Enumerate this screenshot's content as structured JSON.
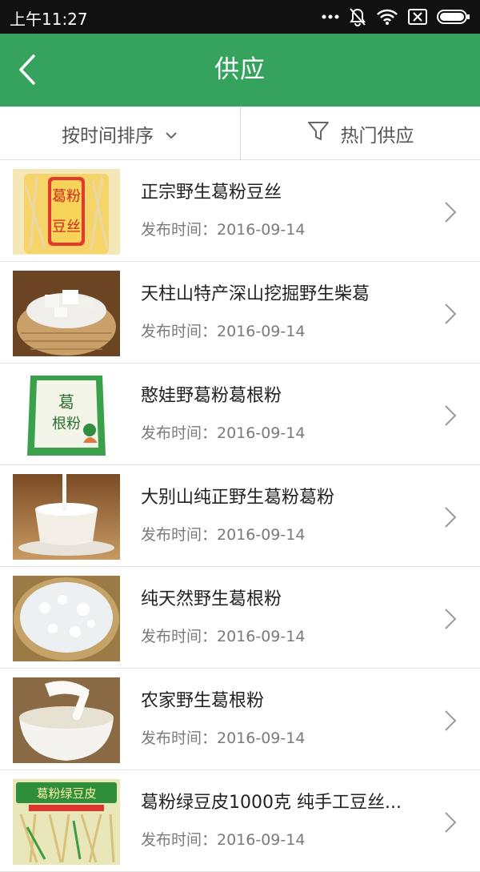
{
  "status_bar": {
    "time": "上午11:27",
    "icons": [
      "more-dots-icon",
      "mute-bell-icon",
      "wifi-icon",
      "sim-x-icon",
      "battery-icon"
    ]
  },
  "header": {
    "title": "供应",
    "back_icon": "back-arrow-icon"
  },
  "filters": {
    "sort_label": "按时间排序",
    "sort_icon": "chevron-down-icon",
    "hot_label": "热门供应",
    "hot_icon": "filter-funnel-icon"
  },
  "colors": {
    "brand": "#35a25d",
    "status_bar": "#111111"
  },
  "list": {
    "items": [
      {
        "title": "正宗野生葛粉豆丝",
        "date": "发布时间：2016-09-14"
      },
      {
        "title": "天柱山特产深山挖掘野生柴葛",
        "date": "发布时间：2016-09-14"
      },
      {
        "title": "憨娃野葛粉葛根粉",
        "date": "发布时间：2016-09-14"
      },
      {
        "title": "大别山纯正野生葛粉葛粉",
        "date": "发布时间：2016-09-14"
      },
      {
        "title": "纯天然野生葛根粉",
        "date": "发布时间：2016-09-14"
      },
      {
        "title": "农家野生葛根粉",
        "date": "发布时间：2016-09-14"
      },
      {
        "title": "葛粉绿豆皮1000克 纯手工豆丝...",
        "date": "发布时间：2016-09-14"
      }
    ]
  }
}
